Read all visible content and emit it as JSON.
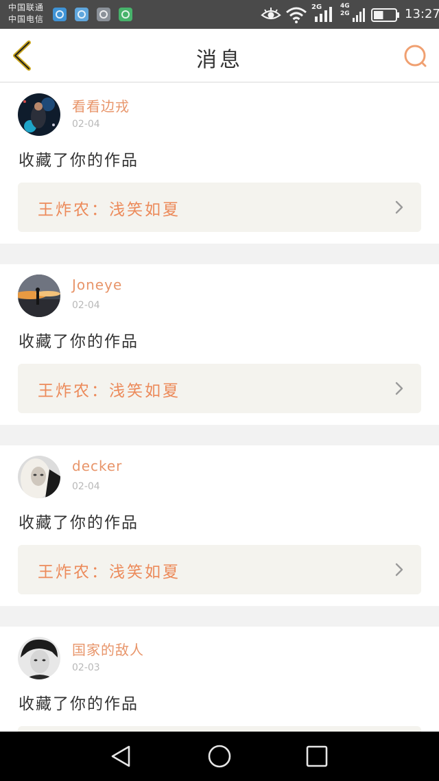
{
  "status_bar": {
    "carrier_1": "中国联通",
    "carrier_2": "中国电信",
    "network_1": "2G",
    "network_2a": "4G",
    "network_2b": "2G",
    "time": "13:27",
    "battery_level": 0.45
  },
  "header": {
    "title": "消息"
  },
  "messages": [
    {
      "username": "看看边戎",
      "date": "02-04",
      "action": "收藏了你的作品",
      "work_title": "王炸农：浅笑如夏"
    },
    {
      "username": "Joneye",
      "date": "02-04",
      "action": "收藏了你的作品",
      "work_title": "王炸农：浅笑如夏"
    },
    {
      "username": "decker",
      "date": "02-04",
      "action": "收藏了你的作品",
      "work_title": "王炸农：浅笑如夏"
    },
    {
      "username": "国家的敌人",
      "date": "02-03",
      "action": "收藏了你的作品",
      "work_title": ""
    }
  ],
  "colors": {
    "accent": "#e8956a",
    "back_icon": "#c9a51d",
    "search_icon": "#f0a071"
  }
}
